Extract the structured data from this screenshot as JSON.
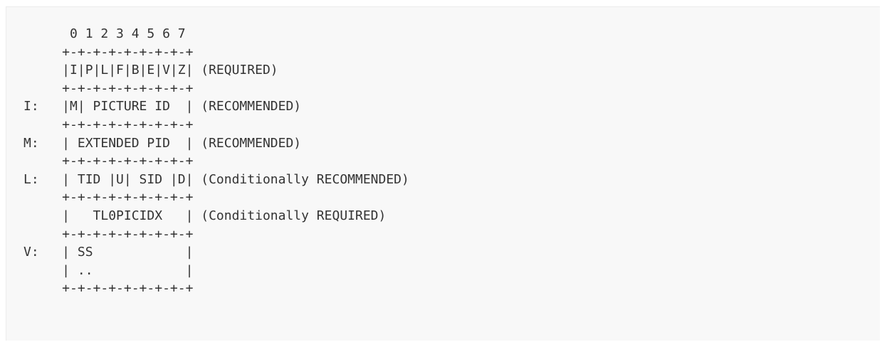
{
  "code_block": {
    "lines": [
      "      0 1 2 3 4 5 6 7",
      "     +-+-+-+-+-+-+-+-+",
      "     |I|P|L|F|B|E|V|Z| (REQUIRED)",
      "     +-+-+-+-+-+-+-+-+",
      "I:   |M| PICTURE ID  | (RECOMMENDED)",
      "     +-+-+-+-+-+-+-+-+",
      "M:   | EXTENDED PID  | (RECOMMENDED)",
      "     +-+-+-+-+-+-+-+-+",
      "L:   | TID |U| SID |D| (Conditionally RECOMMENDED)",
      "     +-+-+-+-+-+-+-+-+",
      "     |   TL0PICIDX   | (Conditionally REQUIRED)",
      "     +-+-+-+-+-+-+-+-+",
      "V:   | SS            |",
      "     | ..            |",
      "     +-+-+-+-+-+-+-+-+"
    ]
  }
}
